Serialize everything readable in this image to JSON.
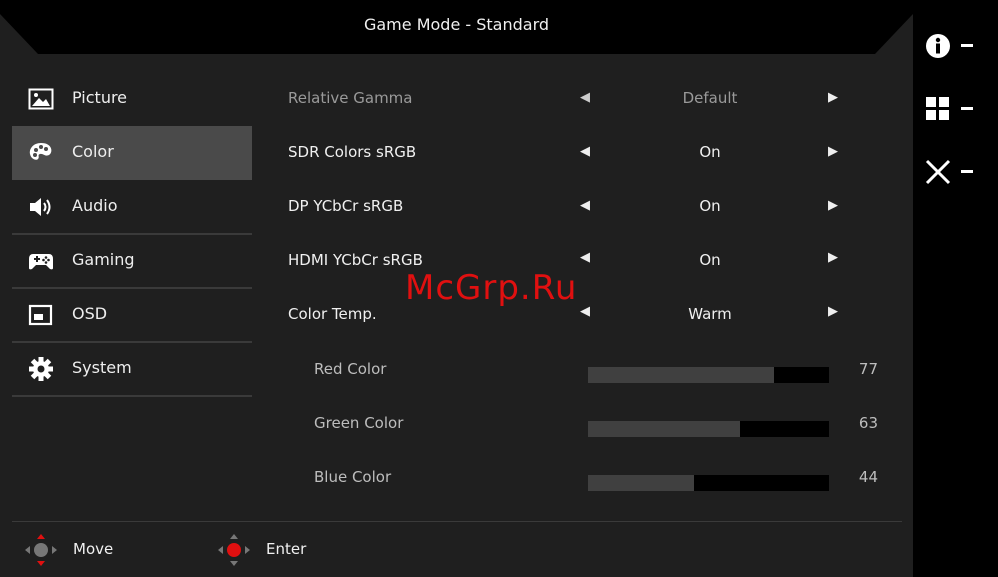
{
  "header": {
    "title": "Game Mode - Standard"
  },
  "nav": [
    {
      "label": "Picture",
      "icon": "picture-icon",
      "active": false
    },
    {
      "label": "Color",
      "icon": "palette-icon",
      "active": true
    },
    {
      "label": "Audio",
      "icon": "speaker-icon",
      "active": false
    },
    {
      "label": "Gaming",
      "icon": "gamepad-icon",
      "active": false
    },
    {
      "label": "OSD",
      "icon": "osd-icon",
      "active": false
    },
    {
      "label": "System",
      "icon": "gear-icon",
      "active": false
    }
  ],
  "settings": [
    {
      "label": "Relative Gamma",
      "value": "Default",
      "dimmed": true
    },
    {
      "label": "SDR Colors sRGB",
      "value": "On",
      "dimmed": false
    },
    {
      "label": "DP YCbCr sRGB",
      "value": "On",
      "dimmed": false
    },
    {
      "label": "HDMI YCbCr sRGB",
      "value": "On",
      "dimmed": false
    },
    {
      "label": "Color Temp.",
      "value": "Warm",
      "dimmed": false
    }
  ],
  "sliders": [
    {
      "label": "Red Color",
      "value": "77",
      "fraction": 0.77
    },
    {
      "label": "Green Color",
      "value": "63",
      "fraction": 0.63
    },
    {
      "label": "Blue Color",
      "value": "44",
      "fraction": 0.44
    }
  ],
  "footer": {
    "move_label": "Move",
    "enter_label": "Enter"
  },
  "side": [
    {
      "icon": "info-icon"
    },
    {
      "icon": "grid-icon"
    },
    {
      "icon": "close-icon"
    }
  ],
  "watermark": "McGrp.Ru",
  "colors": {
    "accent": "#e01010",
    "panel": "#1f1f1f",
    "active": "#4a4a4a"
  }
}
